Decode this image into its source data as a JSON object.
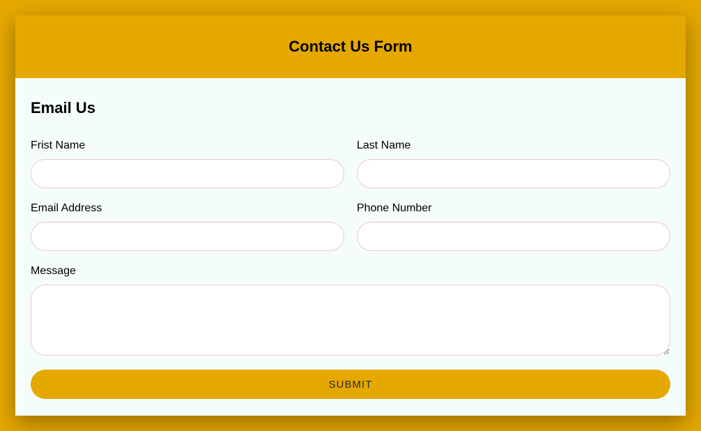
{
  "header": {
    "title": "Contact Us Form"
  },
  "section": {
    "title": "Email Us"
  },
  "fields": {
    "first_name": {
      "label": "Frist Name",
      "value": ""
    },
    "last_name": {
      "label": "Last Name",
      "value": ""
    },
    "email": {
      "label": "Email Address",
      "value": ""
    },
    "phone": {
      "label": "Phone Number",
      "value": ""
    },
    "message": {
      "label": "Message",
      "value": ""
    }
  },
  "submit": {
    "label": "SUBMIT"
  }
}
